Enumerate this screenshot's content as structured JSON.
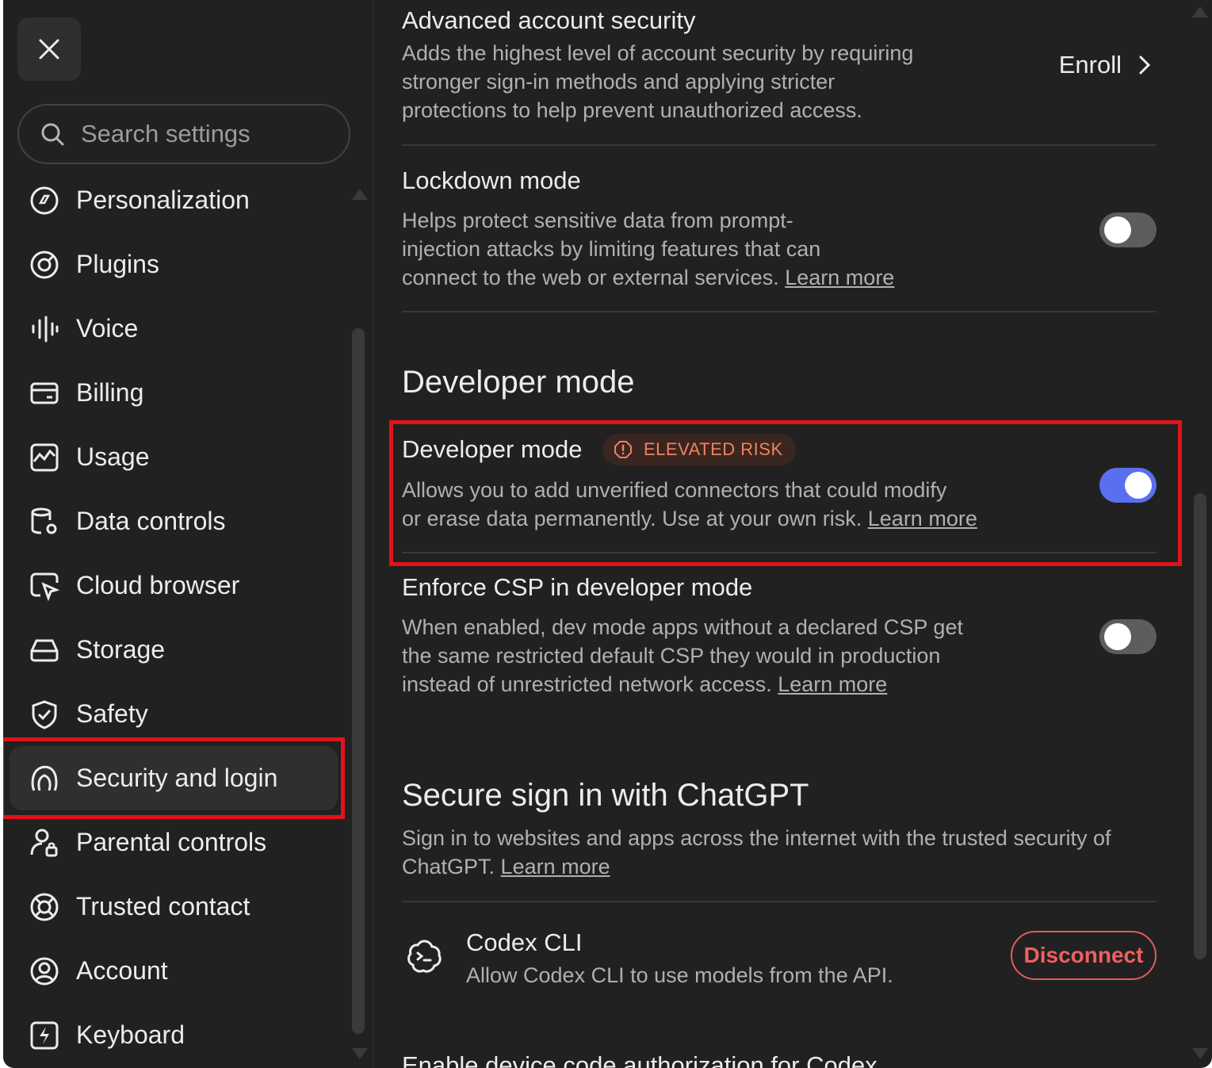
{
  "search": {
    "placeholder": "Search settings"
  },
  "sidebar": {
    "items": [
      {
        "label": "Personalization",
        "icon": "personalization-icon"
      },
      {
        "label": "Plugins",
        "icon": "plugins-icon"
      },
      {
        "label": "Voice",
        "icon": "voice-icon"
      },
      {
        "label": "Billing",
        "icon": "billing-icon"
      },
      {
        "label": "Usage",
        "icon": "usage-icon"
      },
      {
        "label": "Data controls",
        "icon": "data-controls-icon"
      },
      {
        "label": "Cloud browser",
        "icon": "cloud-browser-icon"
      },
      {
        "label": "Storage",
        "icon": "storage-icon"
      },
      {
        "label": "Safety",
        "icon": "shield-icon"
      },
      {
        "label": "Security and login",
        "icon": "security-icon",
        "active": true
      },
      {
        "label": "Parental controls",
        "icon": "parental-controls-icon"
      },
      {
        "label": "Trusted contact",
        "icon": "lifebuoy-icon"
      },
      {
        "label": "Account",
        "icon": "account-icon"
      },
      {
        "label": "Keyboard",
        "icon": "keyboard-icon"
      }
    ]
  },
  "advanced": {
    "title": "Advanced account security",
    "desc_1": "Adds the highest level of account security by requiring",
    "desc_2": "stronger sign-in methods and applying stricter",
    "desc_3": "protections to help prevent unauthorized access.",
    "action": "Enroll"
  },
  "lockdown": {
    "title": "Lockdown mode",
    "desc_1": "Helps protect sensitive data from prompt-",
    "desc_2": "injection attacks by limiting features that can",
    "desc_3": "connect to the web or external services. ",
    "link": "Learn more",
    "enabled": false
  },
  "developer_section": {
    "title": "Developer mode"
  },
  "developer": {
    "title": "Developer mode",
    "badge": "ELEVATED RISK",
    "desc_1": "Allows you to add unverified connectors that could modify",
    "desc_2": "or erase data permanently. Use at your own risk. ",
    "link": "Learn more",
    "enabled": true
  },
  "csp": {
    "title": "Enforce CSP in developer mode",
    "desc_1": "When enabled, dev mode apps without a declared CSP get",
    "desc_2": "the same restricted default CSP they would in production",
    "desc_3": "instead of unrestricted network access. ",
    "link": "Learn more",
    "enabled": false
  },
  "secure_signin": {
    "title": "Secure sign in with ChatGPT",
    "desc_1": "Sign in to websites and apps across the internet with the trusted security of",
    "desc_2": "ChatGPT. ",
    "link": "Learn more"
  },
  "codex": {
    "title": "Codex CLI",
    "desc": "Allow Codex CLI to use models from the API.",
    "action": "Disconnect"
  },
  "cut_off": {
    "text": "Enable device code authorization for Codex"
  },
  "colors": {
    "accent": "#5a6ff0",
    "danger": "#e25c5c",
    "highlight": "#e0131a"
  }
}
